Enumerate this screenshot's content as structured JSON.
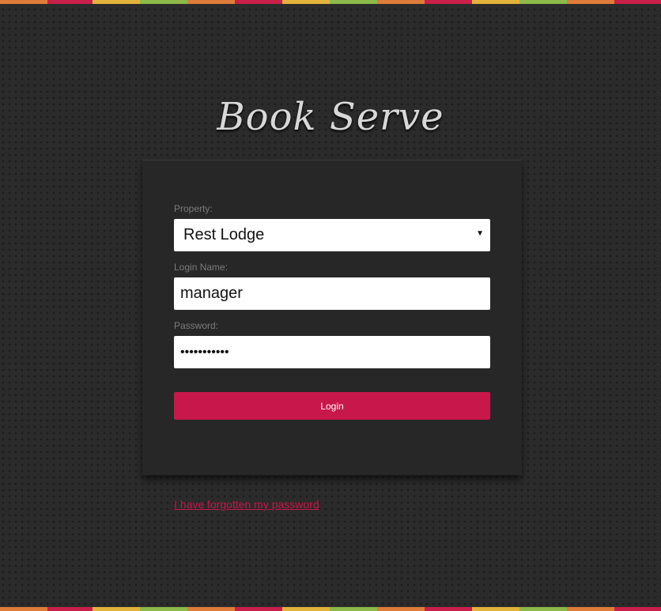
{
  "brand": {
    "title": "Book Serve"
  },
  "login_form": {
    "property_label": "Property:",
    "property_value": "Rest Lodge",
    "login_name_label": "Login Name:",
    "login_name_value": "manager",
    "password_label": "Password:",
    "password_value": "•••••••••••",
    "login_button_label": "Login"
  },
  "links": {
    "forgot_password": "I have forgotten my password"
  },
  "colors": {
    "accent": "#c8174a",
    "background": "#2b2b2b",
    "panel": "#272727",
    "label": "#7c7c7c"
  },
  "icons": {
    "select_arrow": "caret-down-icon"
  }
}
